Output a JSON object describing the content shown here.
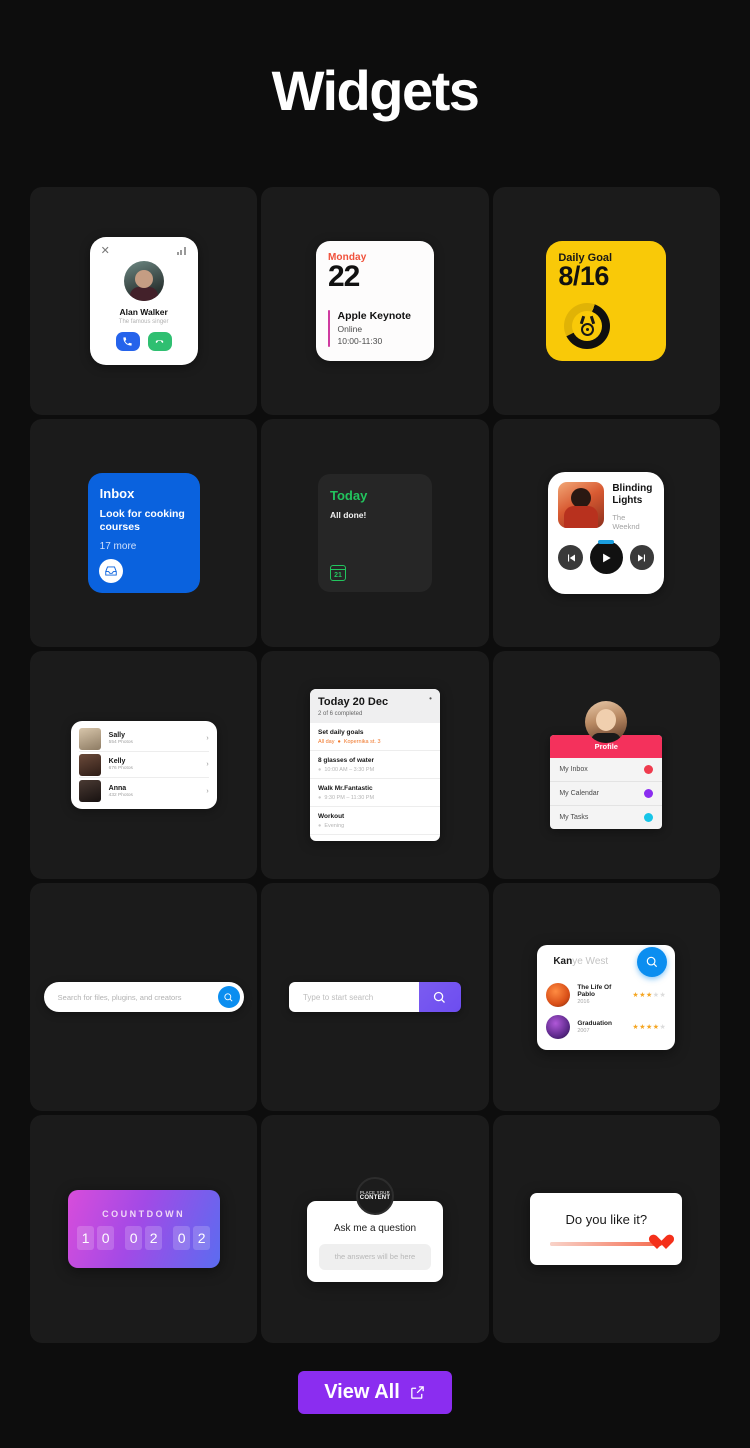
{
  "header": {
    "title": "Widgets"
  },
  "footer": {
    "view_all_label": "View All",
    "icon": "external-link-icon",
    "accent": "#8b2df0"
  },
  "widgets": {
    "call": {
      "name": "Alan Walker",
      "subtitle": "The famous singer",
      "close_icon": "close-icon",
      "signal_icon": "signal-bars-icon",
      "accept_icon": "phone-icon",
      "decline_icon": "phone-hangup-icon",
      "accept_color": "#2563eb",
      "decline_color": "#2fbf71"
    },
    "calendar": {
      "day_of_week": "Monday",
      "day_number": "22",
      "event_title": "Apple Keynote",
      "event_location": "Online",
      "event_time": "10:00-11:30",
      "dow_color": "#f0503a",
      "bar_color": "#cf3ba0"
    },
    "daily_goal": {
      "title": "Daily Goal",
      "value": "8/16",
      "progress_percent": 62,
      "icon": "medal-icon",
      "bg": "#f9c908"
    },
    "inbox": {
      "title": "Inbox",
      "message": "Look for cooking courses",
      "count": "17 more",
      "icon": "inbox-tray-icon",
      "bg": "#0a62de"
    },
    "today": {
      "title": "Today",
      "status": "All done!",
      "icon": "calendar-icon",
      "icon_day": "21",
      "accent": "#22c55e"
    },
    "music": {
      "track": "Blinding Lights",
      "artist": "The Weeknd",
      "prev_icon": "skip-back-icon",
      "play_icon": "play-icon",
      "next_icon": "skip-forward-icon"
    },
    "photos": {
      "items": [
        {
          "name": "Sally",
          "count": "554 Photos",
          "chevron": "chevron-right-icon"
        },
        {
          "name": "Kelly",
          "count": "676 Photos",
          "chevron": "chevron-right-icon"
        },
        {
          "name": "Anna",
          "count": "432 Photos",
          "chevron": "chevron-right-icon"
        }
      ]
    },
    "tasks": {
      "title": "Today 20 Dec",
      "progress": "2 of 6 completed",
      "menu_icon": "more-horizontal-icon",
      "items": [
        {
          "name": "Set daily goals",
          "when": "All day",
          "place": "Kopernika st. 3"
        },
        {
          "name": "8 glasses of water",
          "when": "10:00 AM – 3:30 PM",
          "place": ""
        },
        {
          "name": "Walk Mr.Fantastic",
          "when": "9:30 PM – 11:30 PM",
          "place": ""
        },
        {
          "name": "Workout",
          "when": "Evening",
          "place": ""
        }
      ]
    },
    "profile": {
      "header": "Profile",
      "avatar": "user-avatar",
      "header_color": "#f4315c",
      "items": [
        {
          "label": "My Inbox",
          "badge_icon": "inbox-badge-icon",
          "badge_color": "#ef3b4e"
        },
        {
          "label": "My Calendar",
          "badge_icon": "calendar-badge-icon",
          "badge_color": "#8b2df0"
        },
        {
          "label": "My Tasks",
          "badge_icon": "tasks-badge-icon",
          "badge_color": "#17c5e8"
        }
      ]
    },
    "search_pill": {
      "placeholder": "Search for files, plugins, and creators",
      "button_icon": "search-icon",
      "button_color": "#0b8ef0"
    },
    "search_box": {
      "placeholder": "Type to start search",
      "button_icon": "search-icon",
      "button_color": "#6d4df0"
    },
    "search_suggest": {
      "typed": "Kan",
      "suggestion": "ye West",
      "button_icon": "search-icon",
      "button_color": "#0b8ef0",
      "results": [
        {
          "title": "The Life Of Pablo",
          "year": "2016",
          "stars": 3,
          "max_stars": 5
        },
        {
          "title": "Graduation",
          "year": "2007",
          "stars": 4,
          "max_stars": 5
        }
      ]
    },
    "countdown": {
      "title": "COUNTDOWN",
      "digits": [
        "1",
        "0",
        "0",
        "2",
        "0",
        "2"
      ]
    },
    "ask": {
      "avatar_line1": "PLACE YOUR",
      "avatar_line2": "CONTENT",
      "question": "Ask me a question",
      "answer_placeholder": "the answers will be here"
    },
    "like": {
      "question": "Do you like it?",
      "slider_value": 100,
      "handle_icon": "heart-icon",
      "handle_color": "#f4301a"
    }
  }
}
